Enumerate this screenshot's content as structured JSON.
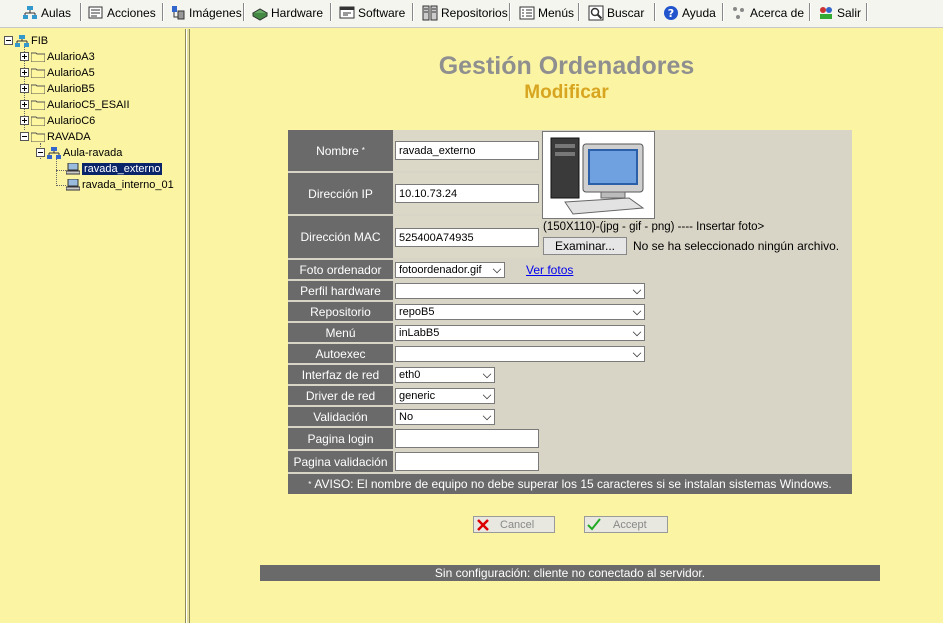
{
  "menu": [
    {
      "label": "Aulas",
      "icon": "classrooms-icon"
    },
    {
      "label": "Acciones",
      "icon": "actions-icon"
    },
    {
      "label": "Imágenes",
      "icon": "images-icon"
    },
    {
      "label": "Hardware",
      "icon": "hardware-icon"
    },
    {
      "label": "Software",
      "icon": "software-icon"
    },
    {
      "label": "Repositorios",
      "icon": "repositories-icon"
    },
    {
      "label": "Menús",
      "icon": "menus-icon"
    },
    {
      "label": "Buscar",
      "icon": "search-icon"
    },
    {
      "label": "Ayuda",
      "icon": "help-icon"
    },
    {
      "label": "Acerca de",
      "icon": "about-icon"
    },
    {
      "label": "Salir",
      "icon": "exit-icon"
    }
  ],
  "tree": {
    "root": "FIB",
    "folders": [
      "AularioA3",
      "AularioA5",
      "AularioB5",
      "AularioC5_ESAII",
      "AularioC6",
      "RAVADA"
    ],
    "aula": "Aula-ravada",
    "computers": [
      "ravada_externo",
      "ravada_interno_01"
    ]
  },
  "page": {
    "title": "Gestión Ordenadores",
    "subtitle": "Modificar"
  },
  "form": {
    "nombre_label": "Nombre",
    "required_mark": "*",
    "nombre_value": "ravada_externo",
    "ip_label": "Dirección IP",
    "ip_value": "10.10.73.24",
    "mac_label": "Dirección MAC",
    "mac_value": "525400A74935",
    "photo_hint": "(150X110)-(jpg - gif - png) ---- Insertar foto>",
    "browse_button": "Examinar...",
    "no_file_text": "No se ha seleccionado ningún archivo.",
    "foto_label": "Foto ordenador",
    "foto_value": "fotoordenador.gif",
    "ver_fotos": "Ver fotos",
    "perfil_label": "Perfil hardware",
    "perfil_value": "",
    "repo_label": "Repositorio",
    "repo_value": "repoB5",
    "menu_label": "Menú",
    "menu_value": "inLabB5",
    "autoexec_label": "Autoexec",
    "autoexec_value": "",
    "iface_label": "Interfaz de red",
    "iface_value": "eth0",
    "driver_label": "Driver de red",
    "driver_value": "generic",
    "valid_label": "Validación",
    "valid_value": "No",
    "login_label": "Pagina login",
    "login_value": "",
    "pvalid_label": "Pagina validación",
    "pvalid_value": "",
    "aviso_mark": "*",
    "aviso": "AVISO: El nombre de equipo no debe superar los 15 caracteres si se instalan sistemas Windows."
  },
  "buttons": {
    "cancel": "Cancel",
    "accept": "Accept"
  },
  "status": "Sin configuración: cliente no conectado al servidor."
}
